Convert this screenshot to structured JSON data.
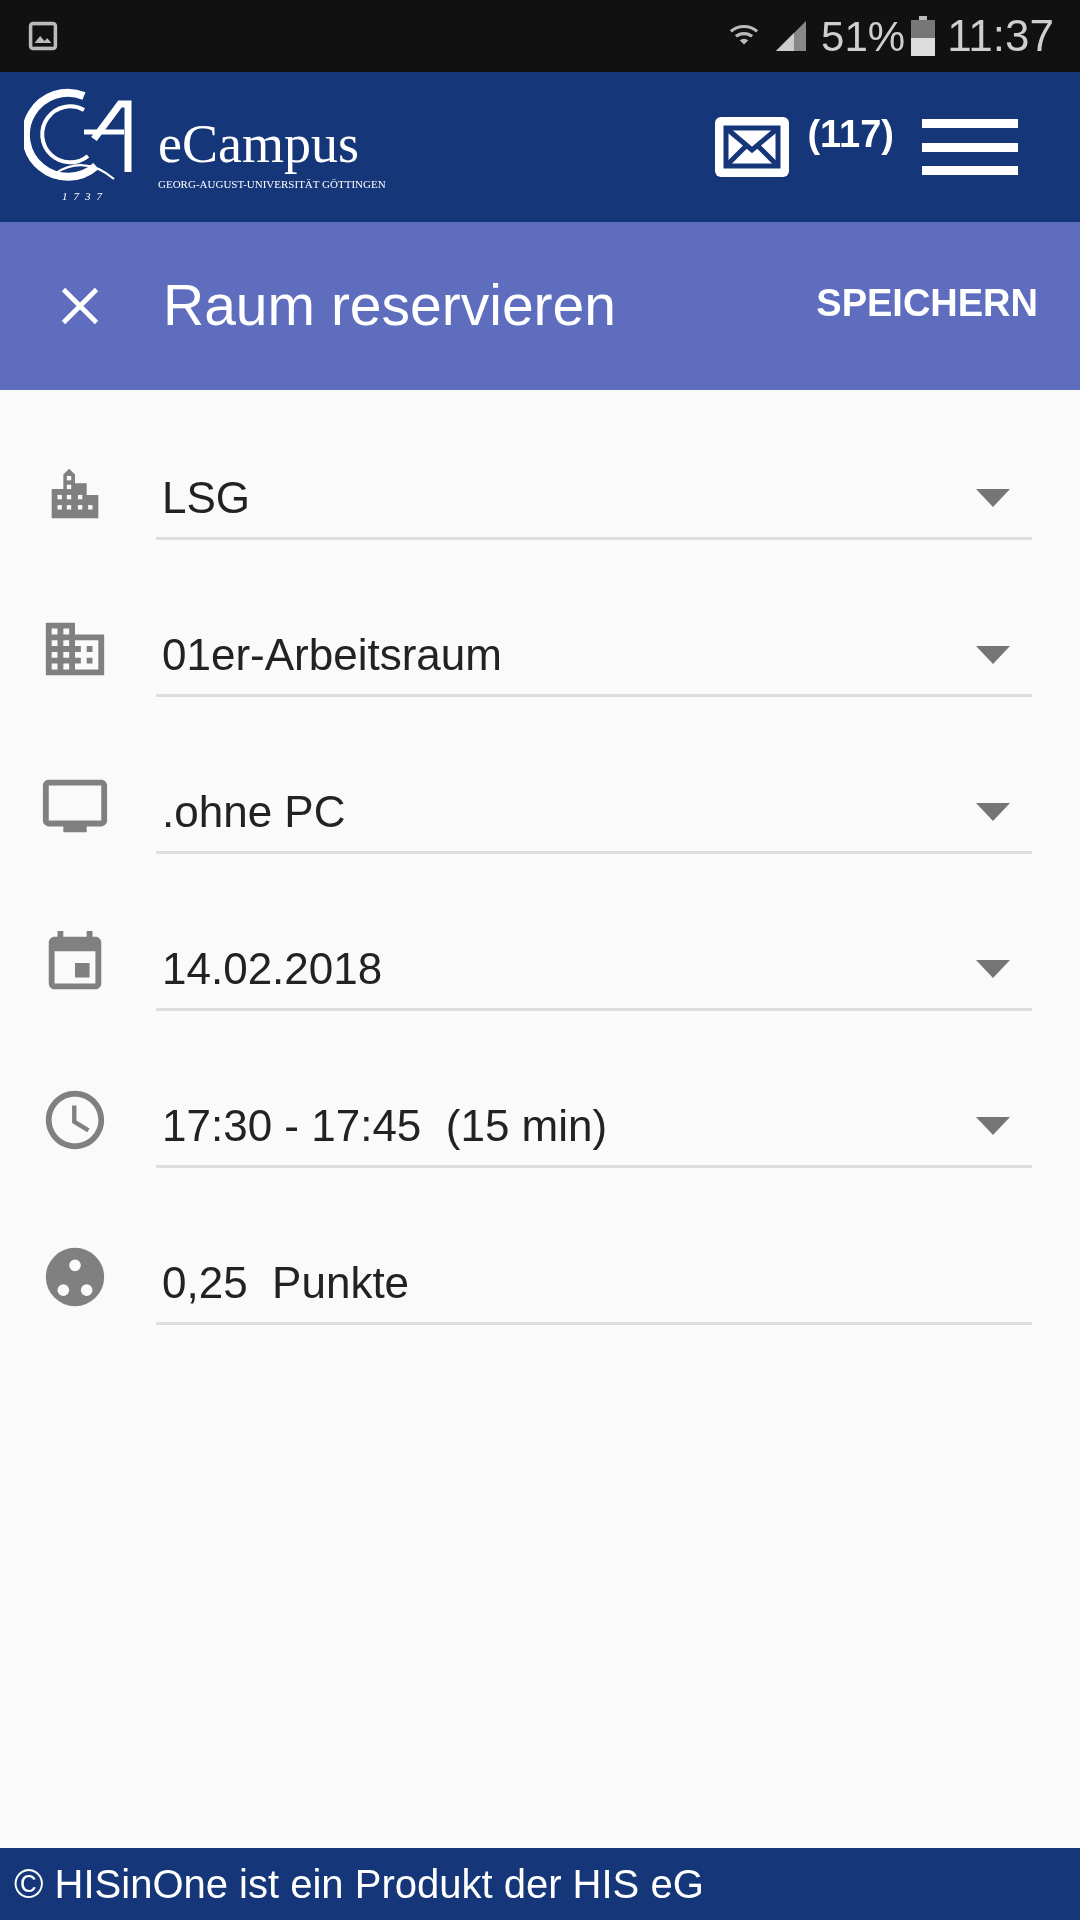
{
  "status_bar": {
    "battery": "51%",
    "time": "11:37"
  },
  "header": {
    "brand": "eCampus",
    "subtitle": "GEORG-AUGUST-UNIVERSITÄT GÖTTINGEN",
    "year": "1737",
    "mail_count": "(117)"
  },
  "toolbar": {
    "title": "Raum reservieren",
    "action": "SPEICHERN"
  },
  "fields": [
    {
      "value": "LSG",
      "kind": "select"
    },
    {
      "value": "01er-Arbeitsraum",
      "kind": "select"
    },
    {
      "value": ".ohne PC",
      "kind": "select"
    },
    {
      "value": "14.02.2018",
      "kind": "select"
    },
    {
      "value": "17:30 - 17:45  (15 min)",
      "kind": "select"
    },
    {
      "value": "0,25  Punkte",
      "kind": "text"
    }
  ],
  "footer": "© HISinOne ist ein Produkt der HIS eG"
}
